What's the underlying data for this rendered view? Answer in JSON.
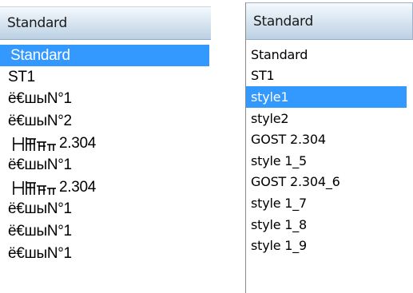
{
  "left_combo": {
    "header": "Standard",
    "items": [
      {
        "label": "Standard",
        "selected": true
      },
      {
        "label": "ST1"
      },
      {
        "label": "ё€шыN°1"
      },
      {
        "label": "ё€шыN°2"
      },
      {
        "label": "2.304",
        "icon": "garbled-glyph-icon"
      },
      {
        "label": "ё€шыN°1"
      },
      {
        "label": "2.304",
        "icon": "garbled-glyph-icon"
      },
      {
        "label": "ё€шыN°1"
      },
      {
        "label": "ё€шыN°1"
      },
      {
        "label": "ё€шыN°1"
      }
    ]
  },
  "right_combo": {
    "header": "Standard",
    "items": [
      {
        "label": "Standard"
      },
      {
        "label": "ST1"
      },
      {
        "label": "style1",
        "selected": true
      },
      {
        "label": "style2"
      },
      {
        "label": "GOST 2.304"
      },
      {
        "label": "style 1_5"
      },
      {
        "label": "GOST 2.304_6"
      },
      {
        "label": "style 1_7"
      },
      {
        "label": "style 1_8"
      },
      {
        "label": "style 1_9"
      }
    ]
  },
  "colors": {
    "selection": "#3399ff",
    "selection_text": "#ffffff",
    "header_gradient_top": "#f4f9fd",
    "header_gradient_bottom": "#bcd0e3"
  }
}
